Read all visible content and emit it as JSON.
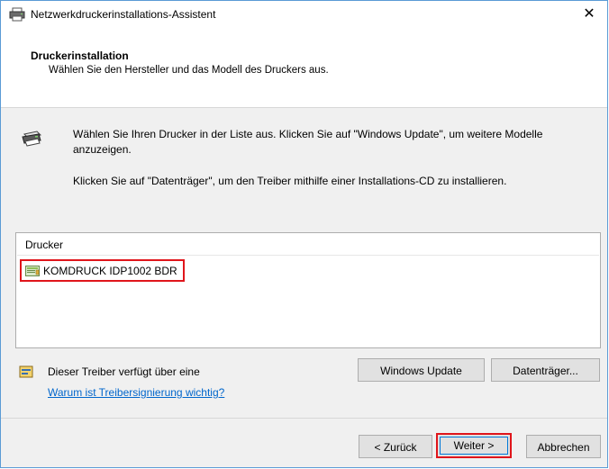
{
  "window": {
    "title": "Netzwerkdruckerinstallations-Assistent",
    "close_glyph": "✕"
  },
  "header": {
    "title": "Druckerinstallation",
    "subtitle": "Wählen Sie den Hersteller und das Modell des Druckers aus."
  },
  "instructions": {
    "line1": "Wählen Sie Ihren Drucker in der Liste aus. Klicken Sie auf \"Windows Update\", um weitere Modelle anzuzeigen.",
    "line2": "Klicken Sie auf \"Datenträger\", um den Treiber mithilfe einer Installations-CD zu installieren."
  },
  "printer_list": {
    "header": "Drucker",
    "items": [
      {
        "label": "KOMDRUCK IDP1002 BDR",
        "selected": true
      }
    ]
  },
  "signature": {
    "text": "Dieser Treiber verfügt über eine",
    "link": "Warum ist Treibersignierung wichtig?"
  },
  "buttons": {
    "windows_update": "Windows Update",
    "disk": "Datenträger...",
    "back": "< Zurück",
    "next": "Weiter >",
    "cancel": "Abbrechen"
  },
  "colors": {
    "highlight": "#e0151b",
    "link": "#0066cc",
    "accent": "#0078d7"
  }
}
